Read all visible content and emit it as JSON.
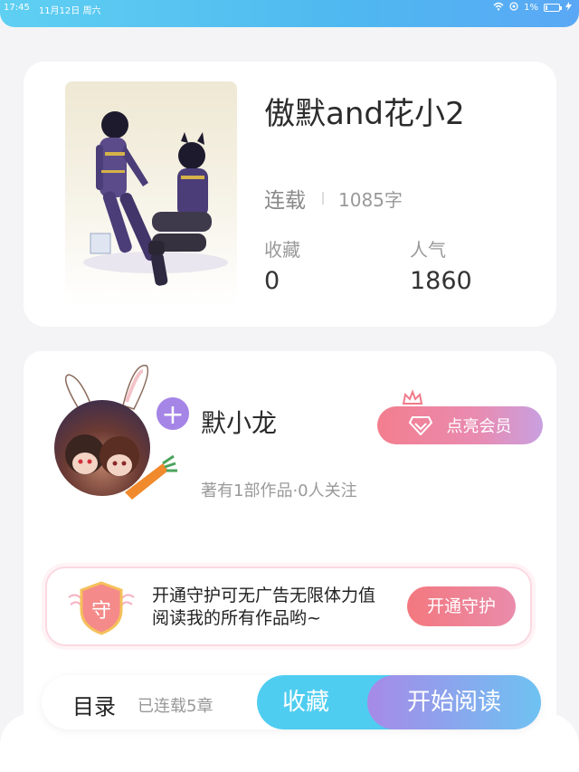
{
  "status_bar": {
    "time": "17:45",
    "date": "11月12日 周六",
    "battery": "1%"
  },
  "book": {
    "title": "傲默and花小2",
    "status": "连载",
    "word_count": "1085字",
    "favorites_label": "收藏",
    "favorites_value": "0",
    "popularity_label": "人气",
    "popularity_value": "1860"
  },
  "author": {
    "name": "默小龙",
    "stats": "著有1部作品·0人关注",
    "vip_button": "点亮会员",
    "follow_symbol": "+"
  },
  "guard": {
    "badge_char": "守",
    "text": "开通守护可无广告无限体力值阅读我的所有作品哟~",
    "button": "开通守护"
  },
  "action_bar": {
    "toc": "目录",
    "chapters": "已连载5章",
    "favorite": "收藏",
    "start_reading": "开始阅读"
  },
  "colors": {
    "accent_blue": "#4fcdf0",
    "accent_purple": "#a585e6",
    "accent_pink": "#f3787e"
  }
}
